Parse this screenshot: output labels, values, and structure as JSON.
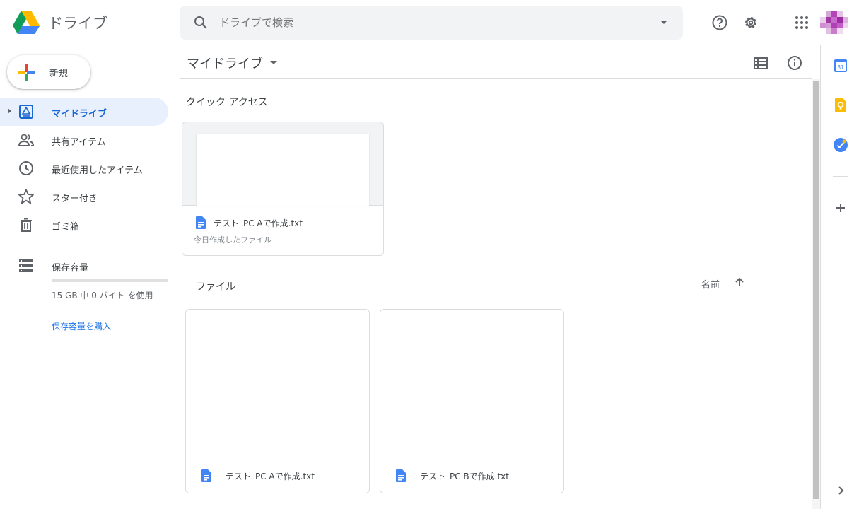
{
  "header": {
    "app_title": "ドライブ",
    "search_placeholder": "ドライブで検索",
    "icons": [
      "drive-logo",
      "search-icon",
      "help-icon",
      "settings-icon",
      "apps-grid-icon",
      "account-avatar"
    ]
  },
  "sidebar": {
    "new_label": "新規",
    "items": [
      {
        "label": "マイドライブ",
        "icon": "my-drive-icon",
        "active": true
      },
      {
        "label": "共有アイテム",
        "icon": "shared-icon",
        "active": false
      },
      {
        "label": "最近使用したアイテム",
        "icon": "recent-icon",
        "active": false
      },
      {
        "label": "スター付き",
        "icon": "star-icon",
        "active": false
      },
      {
        "label": "ゴミ箱",
        "icon": "trash-icon",
        "active": false
      }
    ],
    "storage": {
      "label": "保存容量",
      "usage_text": "15 GB 中 0 バイト を使用",
      "used_fraction": 0,
      "buy_label": "保存容量を購入"
    }
  },
  "main": {
    "title": "マイドライブ",
    "quick_access": {
      "title": "クイック アクセス",
      "items": [
        {
          "name": "テスト_PC Aで作成.txt",
          "subtitle": "今日作成したファイル"
        }
      ]
    },
    "files": {
      "title": "ファイル",
      "sort_label": "名前",
      "items": [
        {
          "name": "テスト_PC Aで作成.txt"
        },
        {
          "name": "テスト_PC Bで作成.txt"
        }
      ]
    }
  },
  "side_panel": {
    "calendar_day": "31",
    "icons": [
      "calendar-icon",
      "keep-icon",
      "tasks-icon",
      "add-icon",
      "expand-icon"
    ]
  },
  "colors": {
    "accent": "#1a73e8",
    "active_bg": "#e8f0fe",
    "active_text": "#1967d2",
    "doc_blue": "#4285f4"
  }
}
